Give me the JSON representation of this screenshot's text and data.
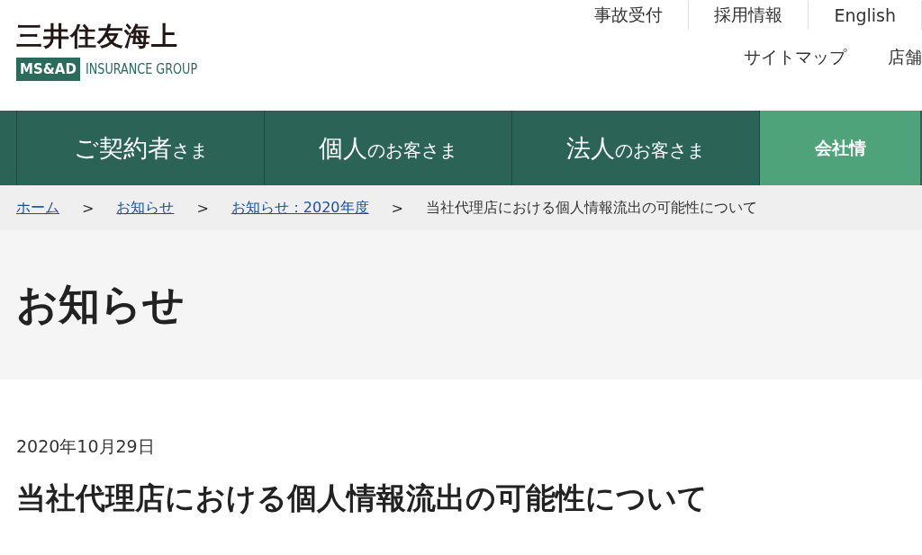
{
  "logo": {
    "name": "三井住友海上",
    "badge": "MS&AD",
    "group": "INSURANCE GROUP"
  },
  "utility_links": [
    "事故受付",
    "採用情報",
    "English"
  ],
  "secondary_links": [
    "サイトマップ",
    "店舗"
  ],
  "main_nav": [
    {
      "main": "ご契約者",
      "sub": "さま",
      "selected": false
    },
    {
      "main": "個人",
      "sub": "のお客さま",
      "selected": false
    },
    {
      "main": "法人",
      "sub": "のお客さま",
      "selected": false
    },
    {
      "main": "会社情",
      "selected": true
    }
  ],
  "breadcrumb": {
    "links": [
      "ホーム",
      "お知らせ",
      "お知らせ：2020年度"
    ],
    "separator": ">",
    "current": "当社代理店における個人情報流出の可能性について"
  },
  "page_title": "お知らせ",
  "article": {
    "date": "2020年10月29日",
    "headline": "当社代理店における個人情報流出の可能性について"
  }
}
